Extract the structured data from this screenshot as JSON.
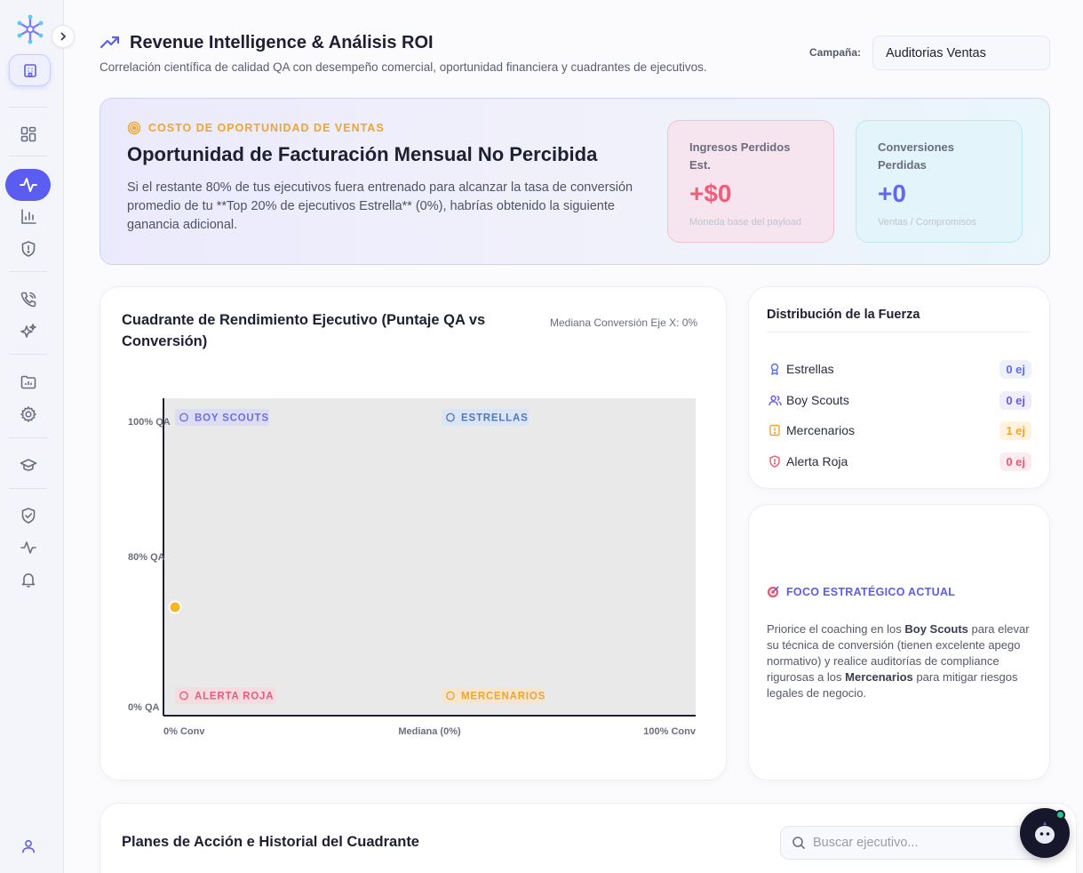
{
  "header": {
    "title": "Revenue Intelligence & Análisis ROI",
    "subtitle": "Correlación científica de calidad QA con desempeño comercial, oportunidad financiera y cuadrantes de ejecutivos.",
    "campaign_label": "Campaña:",
    "campaign_value": "Auditorias Ventas"
  },
  "banner": {
    "kicker": "COSTO DE OPORTUNIDAD DE VENTAS",
    "title": "Oportunidad de Facturación Mensual No Percibida",
    "text": "Si el restante 80% de tus ejecutivos fuera entrenado para alcanzar la tasa de conversión promedio de tu **Top 20% de ejecutivos Estrella** (0%), habrías obtenido la siguiente ganancia adicional.",
    "kpis": [
      {
        "label": "Ingresos Perdidos Est.",
        "value": "+$0",
        "note": "Moneda base del payload"
      },
      {
        "label": "Conversiones Perdidas",
        "value": "+0",
        "note": "Ventas / Compromisos"
      }
    ]
  },
  "chart": {
    "title": "Cuadrante de Rendimiento Ejecutivo (Puntaje QA vs Conversión)",
    "median_note": "Mediana Conversión Eje X: 0%"
  },
  "chart_data": {
    "type": "scatter",
    "title": "Cuadrante de Rendimiento Ejecutivo (Puntaje QA vs Conversión)",
    "xlabel": "",
    "ylabel": "",
    "x_ticks": [
      "0% Conv",
      "Mediana (0%)",
      "100% Conv"
    ],
    "y_ticks": [
      "100% QA",
      "80% QA",
      "0% QA"
    ],
    "xlim": [
      0,
      100
    ],
    "y_scale": "piecewise",
    "quadrants": [
      {
        "label": "BOY SCOUTS",
        "icon": "compass-icon",
        "color": "#6d6fe8"
      },
      {
        "label": "ESTRELLAS",
        "icon": "star-icon",
        "color": "#4d79c9"
      },
      {
        "label": "ALERTA ROJA",
        "icon": "fire-extinguisher-icon",
        "color": "#e85c7a"
      },
      {
        "label": "MERCENARIOS",
        "icon": "warning-icon",
        "color": "#f0a531"
      }
    ],
    "points": [
      {
        "x": 0,
        "y": 53,
        "color": "#f4b728"
      }
    ],
    "grid": false
  },
  "distribution": {
    "title": "Distribución de la Fuerza",
    "rows": [
      {
        "label": "Estrellas",
        "value": "0 ej",
        "icon": "award-icon",
        "color": "#5b6ef0",
        "bg": "#eef0ff"
      },
      {
        "label": "Boy Scouts",
        "value": "0 ej",
        "icon": "users-icon",
        "color": "#6a5bdc",
        "bg": "#f0eefe"
      },
      {
        "label": "Mercenarios",
        "value": "1 ej",
        "icon": "alert-icon",
        "color": "#f0a531",
        "bg": "#fff3e0"
      },
      {
        "label": "Alerta Roja",
        "value": "0 ej",
        "icon": "shield-alert-icon",
        "color": "#ee5873",
        "bg": "#fdecef"
      }
    ]
  },
  "focus": {
    "kicker": "FOCO ESTRATÉGICO ACTUAL",
    "text_1": "Priorice el coaching en los ",
    "bold_1": "Boy Scouts",
    "text_2": " para elevar su técnica de conversión (tienen excelente apego normativo) y realice auditorías de compliance rigurosas a los ",
    "bold_2": "Mercenarios",
    "text_3": " para mitigar riesgos legales de negocio."
  },
  "table": {
    "title": "Planes de Acción e Historial del Cuadrante",
    "search_placeholder": "Buscar ejecutivo..."
  }
}
